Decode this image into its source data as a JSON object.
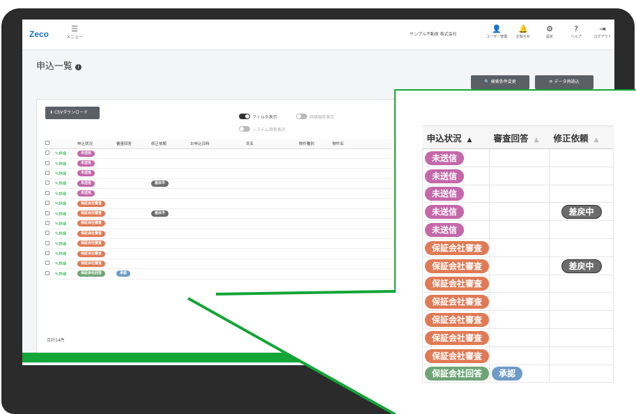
{
  "app": {
    "logo": "Zeco",
    "menu_label": "メニュー",
    "company": "サンプル不動産 株式会社",
    "topbar_icons": [
      {
        "icon": "user-icon",
        "label": "ユーザー管理"
      },
      {
        "icon": "bell-icon",
        "label": "お知らせ"
      },
      {
        "icon": "gear-icon",
        "label": "設定"
      },
      {
        "icon": "help-icon",
        "label": "ヘルプ"
      },
      {
        "icon": "logout-icon",
        "label": "ログアウト"
      }
    ]
  },
  "page": {
    "title": "申込一覧",
    "buttons": {
      "search": "検索条件変更",
      "reload": "データ再読込",
      "csv": "CSVダウンロード"
    },
    "toggles": {
      "filter": "フィルタ表示",
      "detail": "詳細項目表示",
      "system": "システム項目表示"
    },
    "total": "合計14件"
  },
  "table": {
    "headers": [
      "申込状況",
      "審査回答",
      "修正依頼",
      "お申込日時",
      "氏名",
      "物件種別",
      "物件名"
    ],
    "detail_label": "詳細",
    "rows": [
      {
        "status": "未送信",
        "status_color": "#c468a9",
        "review": "",
        "fix": ""
      },
      {
        "status": "未送信",
        "status_color": "#c468a9",
        "review": "",
        "fix": ""
      },
      {
        "status": "未送信",
        "status_color": "#c468a9",
        "review": "",
        "fix": ""
      },
      {
        "status": "未送信",
        "status_color": "#c468a9",
        "review": "",
        "fix": "差戻中"
      },
      {
        "status": "未送信",
        "status_color": "#c468a9",
        "review": "",
        "fix": ""
      },
      {
        "status": "保証会社審査",
        "status_color": "#e07a55",
        "review": "",
        "fix": ""
      },
      {
        "status": "保証会社審査",
        "status_color": "#e07a55",
        "review": "",
        "fix": "差戻中"
      },
      {
        "status": "保証会社審査",
        "status_color": "#e07a55",
        "review": "",
        "fix": ""
      },
      {
        "status": "保証会社審査",
        "status_color": "#e07a55",
        "review": "",
        "fix": ""
      },
      {
        "status": "保証会社審査",
        "status_color": "#e07a55",
        "review": "",
        "fix": ""
      },
      {
        "status": "保証会社審査",
        "status_color": "#e07a55",
        "review": "",
        "fix": ""
      },
      {
        "status": "保証会社審査",
        "status_color": "#e07a55",
        "review": "",
        "fix": ""
      },
      {
        "status": "保証会社回答",
        "status_color": "#6ea576",
        "review": "承認",
        "fix": ""
      }
    ]
  },
  "colors": {
    "accent_green": "#13a537",
    "review_blue": "#6f9bc7",
    "fix_gray": "#6c6c6c"
  }
}
